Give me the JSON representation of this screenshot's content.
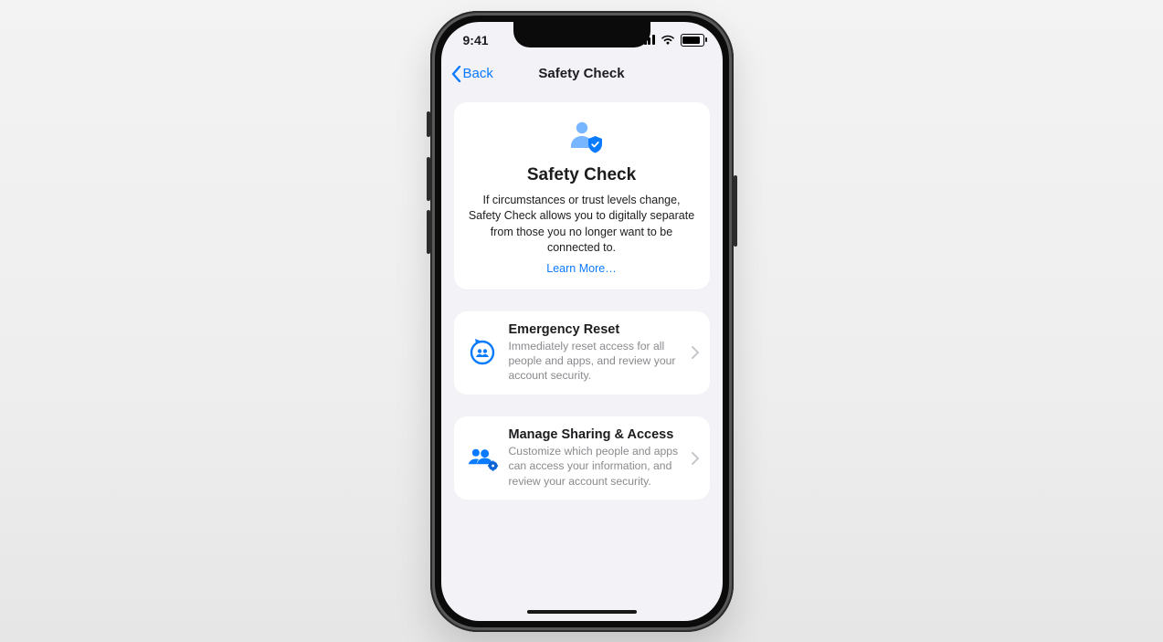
{
  "statusbar": {
    "time": "9:41"
  },
  "navbar": {
    "back_label": "Back",
    "title": "Safety Check"
  },
  "hero": {
    "title": "Safety Check",
    "body": "If circumstances or trust levels change, Safety Check allows you to digitally separate from those you no longer want to be connected to.",
    "learn_more": "Learn More…"
  },
  "rows": [
    {
      "icon": "reset-people-icon",
      "title": "Emergency Reset",
      "desc": "Immediately reset access for all people and apps, and review your account security."
    },
    {
      "icon": "people-gear-icon",
      "title": "Manage Sharing & Access",
      "desc": "Customize which people and apps can access your information, and review your account security."
    }
  ],
  "colors": {
    "accent": "#0a7aff"
  }
}
